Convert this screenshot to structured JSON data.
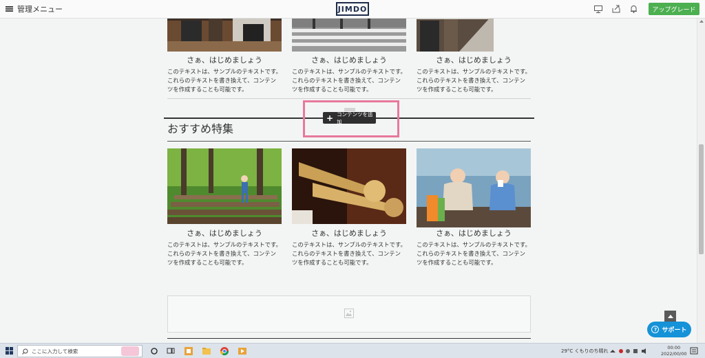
{
  "topbar": {
    "menu_label": "管理メニュー",
    "logo": "JIMDO",
    "icons": [
      "monitor-icon",
      "share-icon",
      "bell-icon"
    ],
    "upgrade_label": "アップグレード",
    "accent_green": "#4caf50"
  },
  "top_cards": [
    {
      "title": "さぁ、はじめましょう",
      "desc": "このテキストは、サンプルのテキストです。これらのテキストを書き換えて、コンテンツを作成することも可能です。"
    },
    {
      "title": "さぁ、はじめましょう",
      "desc": "このテキストは、サンプルのテキストです。これらのテキストを書き換えて、コンテンツを作成することも可能です。"
    },
    {
      "title": "さぁ、はじめましょう",
      "desc": "このテキストは、サンプルのテキストです。これらのテキストを書き換えて、コンテンツを作成することも可能です。"
    }
  ],
  "add_content_label": "コンテンツを追加",
  "section": {
    "title": "おすすめ特集",
    "cards": [
      {
        "title": "さぁ、はじめましょう",
        "desc": "このテキストは、サンプルのテキストです。これらのテキストを書き換えて、コンテンツを作成することも可能です。"
      },
      {
        "title": "さぁ、はじめましょう",
        "desc": "このテキストは、サンプルのテキストです。これらのテキストを書き換えて、コンテンツを作成することも可能です。"
      },
      {
        "title": "さぁ、はじめましょう",
        "desc": "このテキストは、サンプルのテキストです。これらのテキストを書き換えて、コンテンツを作成することも可能です。"
      }
    ]
  },
  "support_label": "サポート",
  "highlight_color": "#e8789c",
  "taskbar": {
    "search_placeholder": "ここに入力して検索",
    "weather": "29°C くもりのち晴れ",
    "time": "00:00",
    "date": "2022/00/00"
  }
}
